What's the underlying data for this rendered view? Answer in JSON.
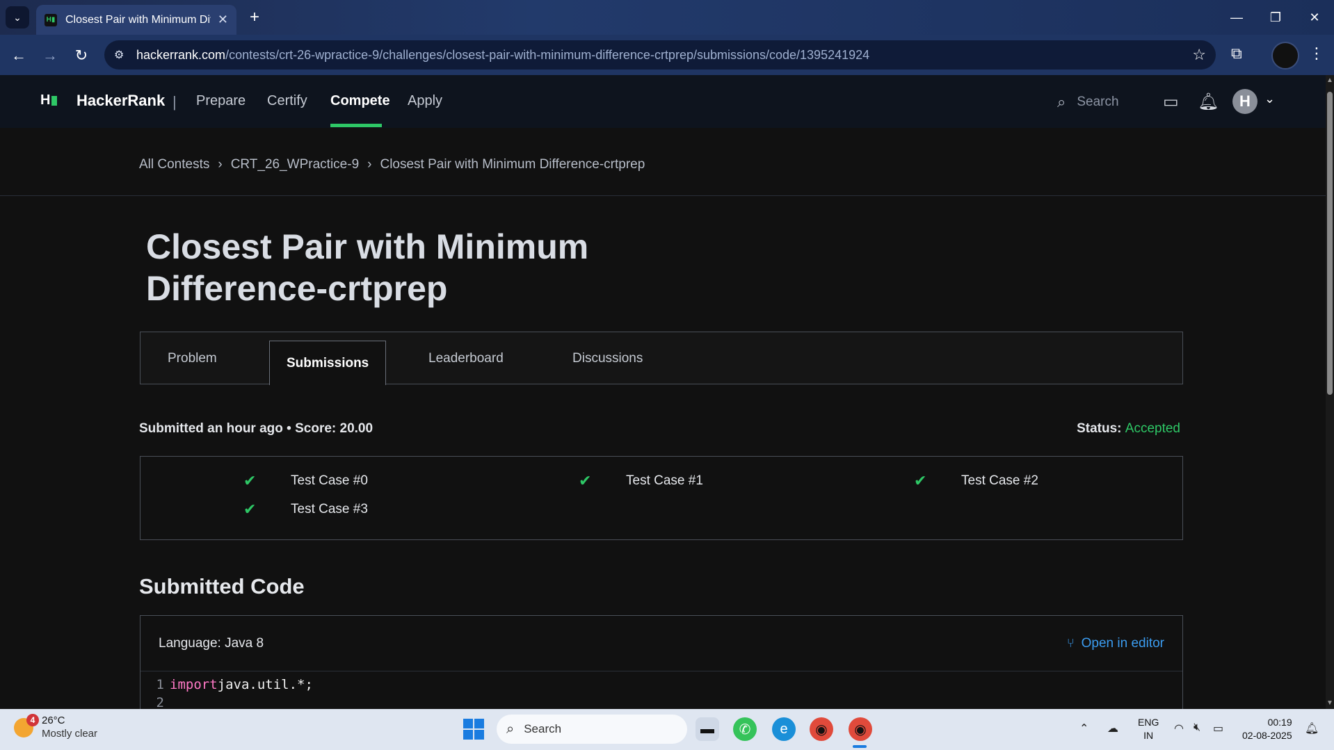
{
  "browser": {
    "tab_title": "Closest Pair with Minimum Diffe",
    "url_domain": "hackerrank.com",
    "url_path": "/contests/crt-26-wpractice-9/challenges/closest-pair-with-minimum-difference-crtprep/submissions/code/1395241924"
  },
  "nav": {
    "brand": "HackerRank",
    "separator": "|",
    "links": [
      "Prepare",
      "Certify",
      "Compete",
      "Apply"
    ],
    "active_link": "Compete",
    "search_placeholder": "Search"
  },
  "breadcrumb": [
    "All Contests",
    "CRT_26_WPractice-9",
    "Closest Pair with Minimum Difference-crtprep"
  ],
  "page_title": "Closest Pair with Minimum Difference-crtprep",
  "tabs": [
    "Problem",
    "Submissions",
    "Leaderboard",
    "Discussions"
  ],
  "active_tab": "Submissions",
  "submission": {
    "summary": "Submitted an hour ago • Score: 20.00",
    "status_label": "Status:",
    "status_value": "Accepted"
  },
  "test_cases": [
    "Test Case #0",
    "Test Case #1",
    "Test Case #2",
    "Test Case #3"
  ],
  "code_section": {
    "heading": "Submitted Code",
    "language": "Language: Java 8",
    "open_in_editor": "Open in editor",
    "lines": [
      {
        "num": "1",
        "keyword": "import",
        "text": " java.util.*;"
      },
      {
        "num": "2",
        "keyword": "",
        "text": ""
      }
    ]
  },
  "taskbar": {
    "weather_badge": "4",
    "temperature": "26°C",
    "condition": "Mostly clear",
    "search_placeholder": "Search",
    "lang_top": "ENG",
    "lang_bottom": "IN",
    "time": "00:19",
    "date": "02-08-2025"
  },
  "colors": {
    "accent_green": "#2ec866",
    "link_blue": "#3b9cf0",
    "page_bg": "#111111",
    "nav_bg": "#0e141e"
  }
}
